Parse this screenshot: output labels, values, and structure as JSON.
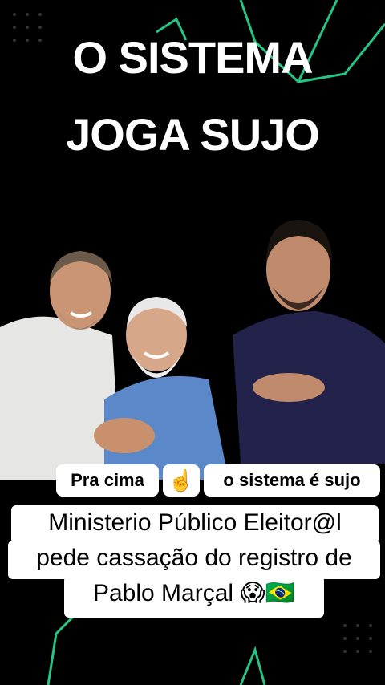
{
  "headline": {
    "line1": "O SISTEMA",
    "line2": "JOGA SUJO"
  },
  "stickers": {
    "left": "Pra cima",
    "middle": "☝️",
    "right": "o sistema é sujo"
  },
  "caption": {
    "line1": "Ministerio Público Eleitor@l",
    "line2": "pede cassação do registro de",
    "line3": "Pablo Marçal 😱🇧🇷"
  },
  "colors": {
    "background": "#000000",
    "accent_line": "#2de89a",
    "text": "#ffffff"
  }
}
